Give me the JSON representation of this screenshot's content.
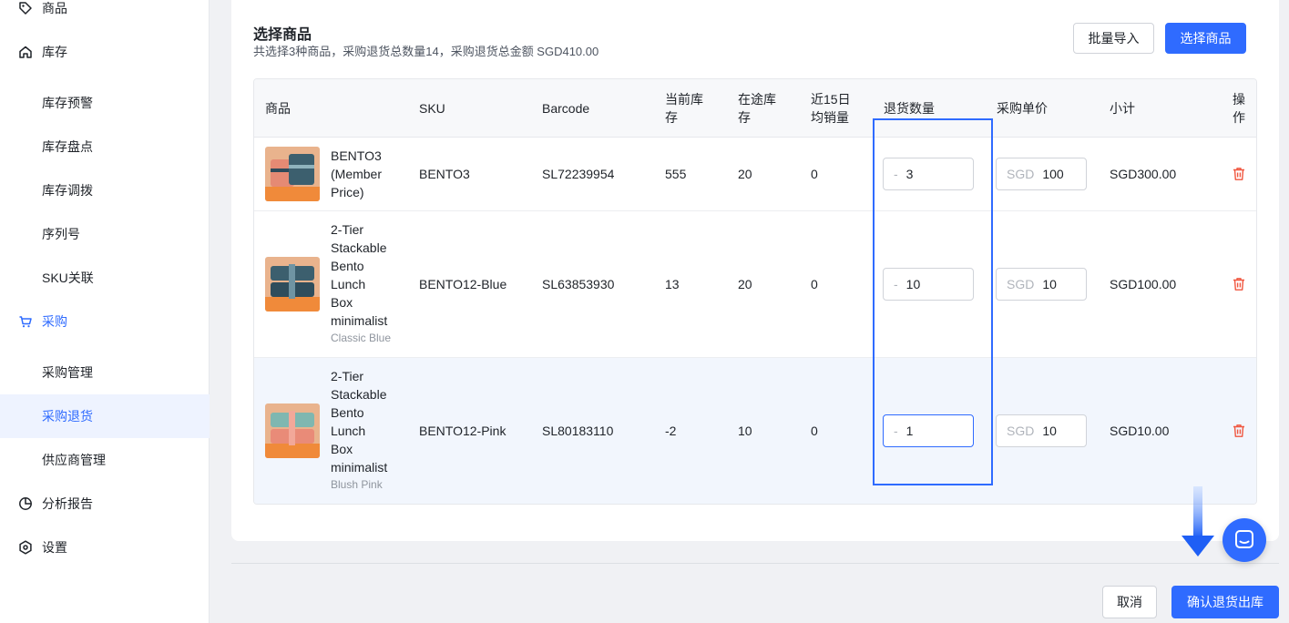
{
  "sidebar": {
    "items": [
      {
        "label": "商品",
        "icon": "tag-icon"
      },
      {
        "label": "库存",
        "icon": "home-icon"
      },
      {
        "label": "库存预警"
      },
      {
        "label": "库存盘点"
      },
      {
        "label": "库存调拨"
      },
      {
        "label": "序列号"
      },
      {
        "label": "SKU关联"
      },
      {
        "label": "采购",
        "icon": "cart-icon"
      },
      {
        "label": "采购管理"
      },
      {
        "label": "采购退货"
      },
      {
        "label": "供应商管理"
      },
      {
        "label": "分析报告",
        "icon": "pie-chart-icon"
      },
      {
        "label": "设置",
        "icon": "settings-icon"
      }
    ],
    "active": "采购退货"
  },
  "card": {
    "title": "选择商品",
    "summary": "共选择3种商品，采购退货总数量14，采购退货总金额 SGD410.00",
    "import_label": "批量导入",
    "select_label": "选择商品"
  },
  "table": {
    "headers": {
      "product": "商品",
      "sku": "SKU",
      "barcode": "Barcode",
      "stock_l1": "当前库",
      "stock_l2": "存",
      "transit_l1": "在途库",
      "transit_l2": "存",
      "sales_l1": "近15日",
      "sales_l2": "均销量",
      "qty": "退货数量",
      "price": "采购单价",
      "subtotal": "小计",
      "action_l1": "操",
      "action_l2": "作"
    },
    "rows": [
      {
        "name_lines": [
          "BENTO3",
          "(Member",
          "Price)"
        ],
        "variant": "",
        "sku": "BENTO3",
        "barcode": "SL72239954",
        "stock": "555",
        "transit": "20",
        "sales": "0",
        "qty_prefix": "-",
        "qty": "3",
        "currency": "SGD",
        "price": "100",
        "subtotal": "SGD300.00"
      },
      {
        "name_lines": [
          "2-Tier",
          "Stackable",
          "Bento",
          "Lunch",
          "Box",
          "minimalist"
        ],
        "variant": "Classic Blue",
        "sku": "BENTO12-Blue",
        "barcode": "SL63853930",
        "stock": "13",
        "transit": "20",
        "sales": "0",
        "qty_prefix": "-",
        "qty": "10",
        "currency": "SGD",
        "price": "10",
        "subtotal": "SGD100.00"
      },
      {
        "name_lines": [
          "2-Tier",
          "Stackable",
          "Bento",
          "Lunch",
          "Box",
          "minimalist"
        ],
        "variant": "Blush Pink",
        "sku": "BENTO12-Pink",
        "barcode": "SL80183110",
        "stock": "-2",
        "transit": "10",
        "sales": "0",
        "qty_prefix": "-",
        "qty": "1",
        "currency": "SGD",
        "price": "10",
        "subtotal": "SGD10.00"
      }
    ]
  },
  "footer": {
    "cancel_label": "取消",
    "confirm_label": "确认退货出库"
  },
  "colors": {
    "primary": "#2f6bff",
    "danger": "#f0563f",
    "active_bg": "#eef3ff"
  }
}
